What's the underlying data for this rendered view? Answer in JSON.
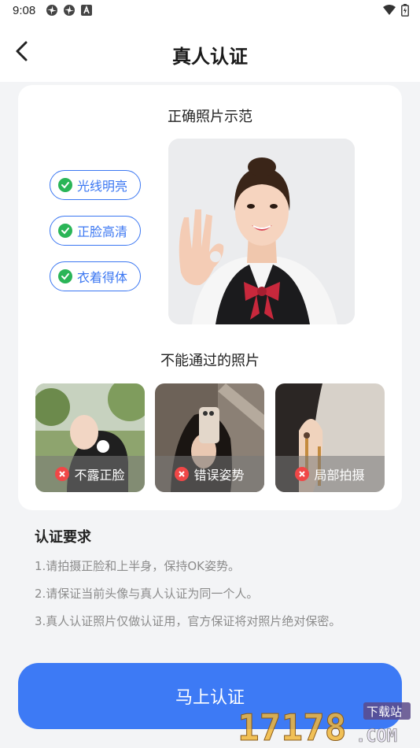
{
  "status_bar": {
    "time": "9:08",
    "left_icons": [
      "pinwheel-icon",
      "pinwheel-icon",
      "a-box-icon"
    ],
    "right_icons": [
      "wifi-icon",
      "battery-icon"
    ]
  },
  "header": {
    "title": "真人认证",
    "back_icon": "chevron-left-icon"
  },
  "correct_section": {
    "title": "正确照片示范",
    "tags": [
      "光线明亮",
      "正脸高清",
      "衣着得体"
    ]
  },
  "fail_section": {
    "title": "不能通过的照片",
    "photos": [
      {
        "label": "不露正脸"
      },
      {
        "label": "错误姿势"
      },
      {
        "label": "局部拍摄"
      }
    ]
  },
  "requirements": {
    "title": "认证要求",
    "items": [
      "1.请拍摄正脸和上半身，保持OK姿势。",
      "2.请保证当前头像与真人认证为同一个人。",
      "3.真人认证照片仅做认证用，官方保证将对照片绝对保密。"
    ]
  },
  "cta": {
    "label": "马上认证"
  },
  "watermark": {
    "main": "17178",
    "suffix": ".COM",
    "badge": "下载站"
  },
  "colors": {
    "accent": "#3d7af5",
    "tag_border": "#3b77f2",
    "check_green": "#2ab557",
    "error_red": "#f04747"
  }
}
